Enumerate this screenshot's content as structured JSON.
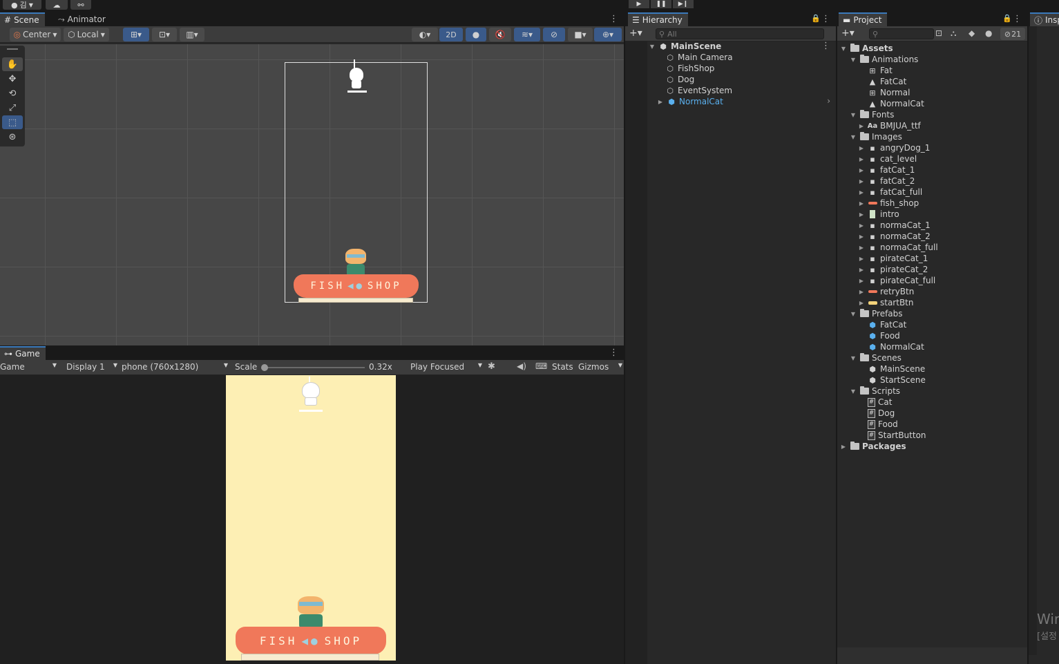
{
  "topbar": {
    "account_label": "김",
    "play_icon": "play-icon",
    "pause_icon": "pause-icon",
    "step_icon": "step-icon"
  },
  "scene_panel": {
    "tabs": [
      {
        "label": "Scene"
      },
      {
        "label": "Animator"
      }
    ],
    "toolbar": {
      "pivot": "Center",
      "space": "Local",
      "mode_2d": "2D"
    }
  },
  "game_panel": {
    "tab": "Game",
    "toolbar": {
      "view": "Game",
      "display": "Display 1",
      "resolution": "phone (760x1280)",
      "scale_label": "Scale",
      "scale_value": "0.32x",
      "scale_fraction": 0.0,
      "play_mode": "Play Focused",
      "stats": "Stats",
      "gizmos": "Gizmos"
    }
  },
  "game_content": {
    "shop_sign_left": "FISH",
    "shop_sign_right": "SHOP"
  },
  "hierarchy": {
    "title": "Hierarchy",
    "search_placeholder": "All",
    "scene": "MainScene",
    "items": [
      {
        "label": "Main Camera"
      },
      {
        "label": "FishShop"
      },
      {
        "label": "Dog"
      },
      {
        "label": "EventSystem"
      },
      {
        "label": "NormalCat"
      }
    ]
  },
  "project": {
    "title": "Project",
    "hidden_count": "21",
    "assets_label": "Assets",
    "animations": {
      "label": "Animations",
      "items": [
        "Fat",
        "FatCat",
        "Normal",
        "NormalCat"
      ]
    },
    "fonts": {
      "label": "Fonts",
      "items": [
        "BMJUA_ttf"
      ]
    },
    "images": {
      "label": "Images",
      "items": [
        "angryDog_1",
        "cat_level",
        "fatCat_1",
        "fatCat_2",
        "fatCat_full",
        "fish_shop",
        "intro",
        "normaCat_1",
        "normaCat_2",
        "normaCat_full",
        "pirateCat_1",
        "pirateCat_2",
        "pirateCat_full",
        "retryBtn",
        "startBtn"
      ]
    },
    "prefabs": {
      "label": "Prefabs",
      "items": [
        "FatCat",
        "Food",
        "NormalCat"
      ]
    },
    "scenes": {
      "label": "Scenes",
      "items": [
        "MainScene",
        "StartScene"
      ]
    },
    "scripts": {
      "label": "Scripts",
      "items": [
        "Cat",
        "Dog",
        "Food",
        "StartButton"
      ]
    },
    "packages_label": "Packages"
  },
  "inspector": {
    "tab": "Insp",
    "watermark_1": "Wir",
    "watermark_2": "[설정"
  },
  "colors": {
    "accent": "#3a79bb",
    "selected_text": "#5ab0ee",
    "game_bg": "#fdefb4",
    "shop_awning": "#f0785a"
  }
}
